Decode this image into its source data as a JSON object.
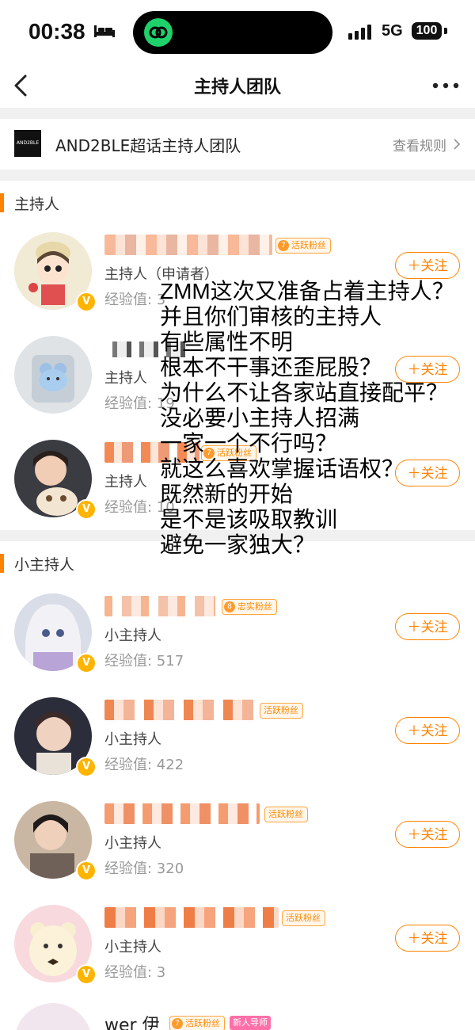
{
  "status_bar": {
    "time": "00:38",
    "network": "5G",
    "battery": "100"
  },
  "nav": {
    "title": "主持人团队"
  },
  "topic": {
    "logo_text": "AND2BLE",
    "name": "AND2BLE超话主持人团队",
    "rules_link": "查看规则"
  },
  "sections": {
    "hosts": {
      "title": "主持人"
    },
    "sub_hosts": {
      "title": "小主持人"
    }
  },
  "members": [
    {
      "fan_level": "7",
      "fan_badge": "活跃粉丝",
      "role": "主持人（申请者）",
      "exp": "经验值: 3",
      "follow": "＋关注"
    },
    {
      "fan_level": "",
      "fan_badge": "",
      "role": "主持人",
      "exp": "经验值: 19",
      "follow": "＋关注"
    },
    {
      "fan_level": "7",
      "fan_badge": "活跃粉丝",
      "role": "主持人",
      "exp": "经验值: 10",
      "follow": "＋关注"
    },
    {
      "fan_level": "8",
      "fan_badge": "忠实粉丝",
      "role": "小主持人",
      "exp": "经验值: 517",
      "follow": "＋关注"
    },
    {
      "fan_level": "7",
      "fan_badge": "活跃粉丝",
      "role": "小主持人",
      "exp": "经验值: 422",
      "follow": "＋关注"
    },
    {
      "fan_level": "7",
      "fan_badge": "活跃粉丝",
      "role": "小主持人",
      "exp": "经验值: 320",
      "follow": "＋关注"
    },
    {
      "fan_level": "7",
      "fan_badge": "活跃粉丝",
      "role": "小主持人",
      "exp": "经验值: 3",
      "follow": "＋关注"
    }
  ],
  "bottom_partial": {
    "name_fragment": "wer 伊",
    "fan_level": "7",
    "fan_badge": "活跃粉丝",
    "mentor_badge": "新人导师"
  },
  "overlay_lines": [
    "ZMM这次又准备占着主持人？",
    "并且你们审核的主持人",
    "有些属性不明",
    "根本不干事还歪屁股？",
    "为什么不让各家站直接配平？",
    "没必要小主持人招满",
    "一家一个不行吗？",
    "就这么喜欢掌握话语权？",
    "既然新的开始",
    "是不是该吸取教训",
    "避免一家独大？"
  ],
  "colors": {
    "accent": "#ff8200",
    "badge": "#ffb400"
  }
}
